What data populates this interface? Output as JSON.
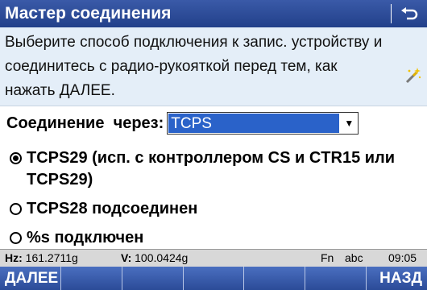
{
  "titlebar": {
    "title": "Мастер соединения",
    "back_icon": "return-arrow-icon"
  },
  "info": {
    "message": "Выберите способ подключения к запис. устройству и соединитесь с радио-рукояткой перед тем, как нажать ДАЛЕЕ.",
    "icon": "magic-wand-icon"
  },
  "connection": {
    "label": "Соединение  через:",
    "selected_value": "TCPS"
  },
  "options": [
    {
      "label": "TCPS29 (исп. с контроллером CS и CTR15 или TCPS29)",
      "checked": true
    },
    {
      "label": "TCPS28 подсоединен",
      "checked": false
    },
    {
      "label": "%s подключен",
      "checked": false
    }
  ],
  "status": {
    "hz_label": "Hz:",
    "hz_value": "161.2711g",
    "v_label": "V:",
    "v_value": "100.0424g",
    "fn": "Fn",
    "input_mode": "abc",
    "time": "09:05"
  },
  "softkeys": [
    "ДАЛЕЕ",
    "",
    "",
    "",
    "",
    "",
    "НАЗД"
  ],
  "colors": {
    "title_bg": "#22408a",
    "info_bg": "#e4eef8",
    "select_highlight": "#2a62c9",
    "softkey_bg": "#2b4b98",
    "status_bg": "#d8d8d8"
  }
}
